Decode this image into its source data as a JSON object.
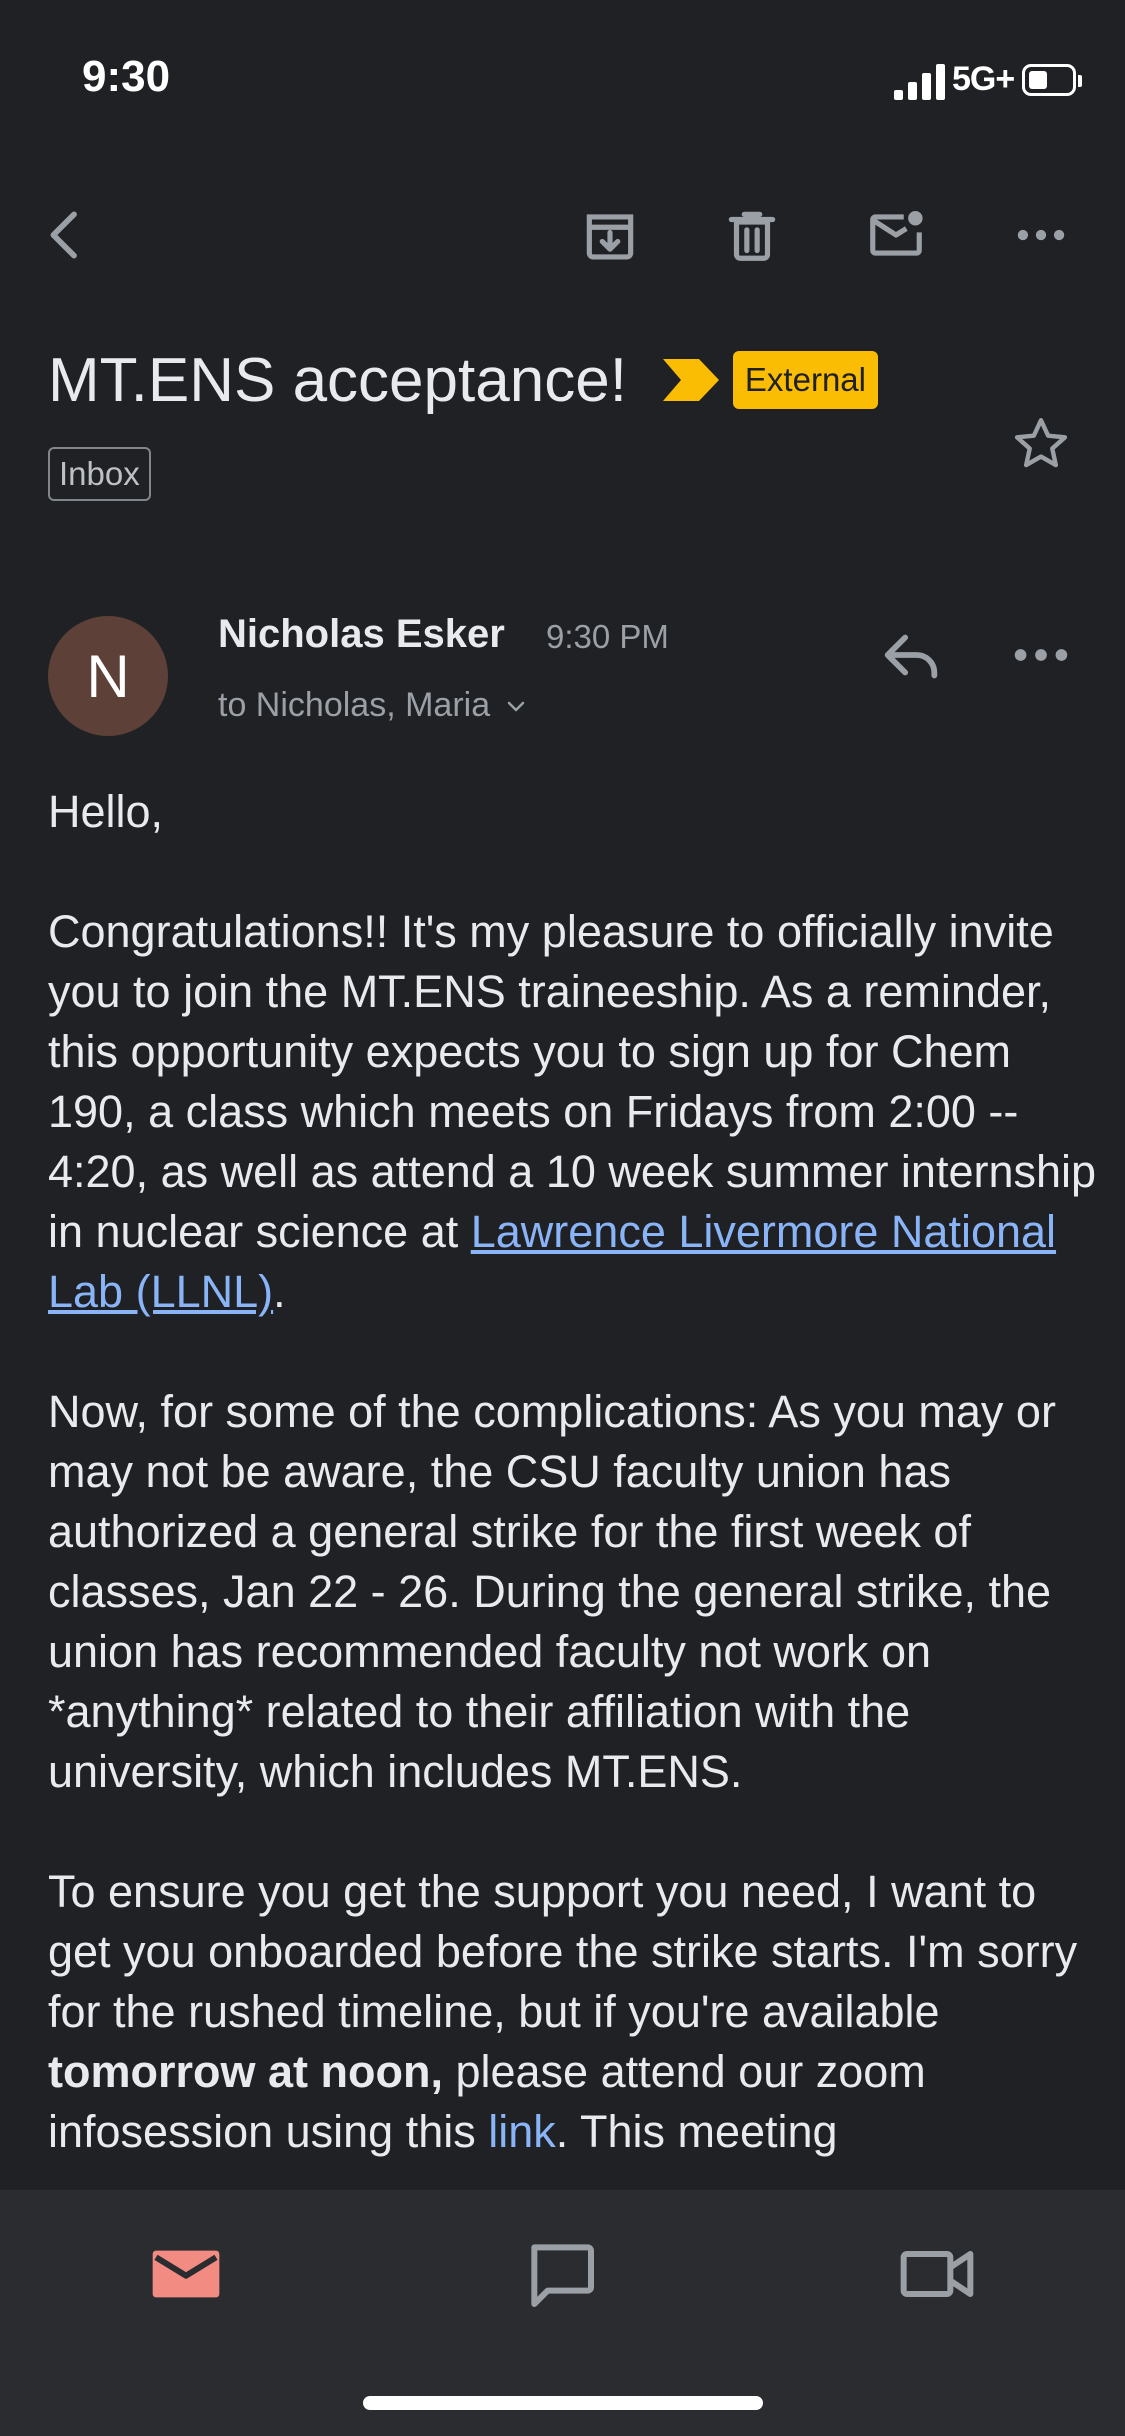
{
  "status_bar": {
    "time": "9:30",
    "network": "5G+"
  },
  "toolbar": {
    "back": "back-arrow-icon",
    "archive": "archive-icon",
    "delete": "trash-icon",
    "mark_unread": "mark-unread-icon",
    "more": "more-horizontal-icon"
  },
  "email": {
    "subject": "MT.ENS acceptance!",
    "external_label": "External",
    "inbox_label": "Inbox",
    "sender_initial": "N",
    "sender_name": "Nicholas Esker",
    "sent_time": "9:30 PM",
    "recipients": "to Nicholas, Maria",
    "body": {
      "greeting": "Hello,",
      "p1_text": "Congratulations!!  It's my pleasure to officially invite you to join the MT.ENS traineeship.  As a reminder, this opportunity expects you to sign up for Chem 190, a class which meets on Fridays from 2:00 -- 4:20, as well as attend a 10 week summer internship in nuclear science at ",
      "p1_link": "Lawrence Livermore National Lab (LLNL)",
      "p1_end": ".",
      "p2_text": "Now, for some of the complications:  As you may or may not be aware, the CSU faculty union has authorized a general strike for the first week of classes, Jan 22 - 26.  During the general strike, the union has recommended faculty not work on *anything* related to their affiliation with the university, which includes MT.ENS.",
      "p3_text": "To ensure you get the support you need, I want to get you onboarded before the strike starts. I'm sorry for the rushed timeline, but if you're available ",
      "p3_bold": "tomorrow at noon,",
      "p3_after": " please attend our zoom infosession using this ",
      "p3_link": "link",
      "p3_end": ".  This meeting"
    }
  },
  "bottom_nav": {
    "mail": "mail-icon",
    "chat": "chat-icon",
    "meet": "video-camera-icon"
  },
  "colors": {
    "background": "#202124",
    "accent_mail": "#f28b82",
    "external_badge": "#fbbc04",
    "link": "#8ab4f8",
    "avatar": "#5d4037"
  }
}
